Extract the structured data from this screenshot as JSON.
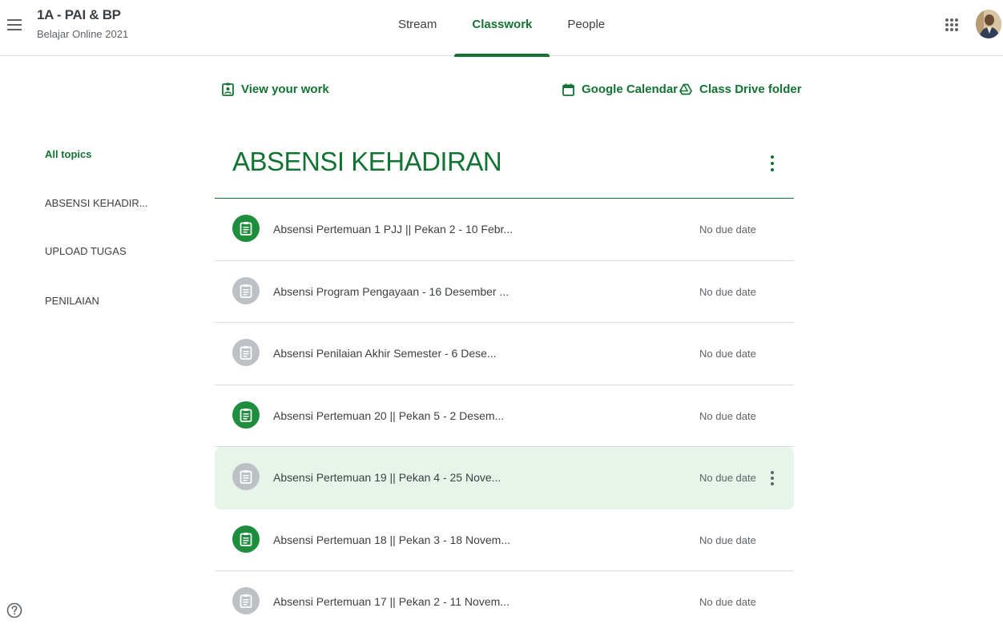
{
  "header": {
    "class_title": "1A - PAI & BP",
    "class_subtitle": "Belajar Online 2021",
    "menu_icon": "hamburger-menu-icon",
    "apps_icon": "google-apps-grid-icon",
    "tabs": [
      {
        "label": "Stream",
        "active": false
      },
      {
        "label": "Classwork",
        "active": true
      },
      {
        "label": "People",
        "active": false
      }
    ]
  },
  "links": {
    "view_work": "View your work",
    "calendar": "Google Calendar",
    "drive": "Class Drive folder"
  },
  "sidebar": {
    "items": [
      {
        "label": "All topics",
        "active": true
      },
      {
        "label": "ABSENSI KEHADIR..."
      },
      {
        "label": "UPLOAD TUGAS"
      },
      {
        "label": "PENILAIAN"
      }
    ]
  },
  "topic": {
    "title": "ABSENSI KEHADIRAN",
    "items": [
      {
        "title": "Absensi Pertemuan 1 PJJ || Pekan 2 - 10 Febr...",
        "due": "No due date",
        "status_color": "#1e8e3e"
      },
      {
        "title": "Absensi Program Pengayaan - 16 Desember ...",
        "due": "No due date",
        "status_color": "#bdc1c6"
      },
      {
        "title": "Absensi Penilaian Akhir Semester - 6 Dese...",
        "due": "No due date",
        "status_color": "#bdc1c6"
      },
      {
        "title": "Absensi Pertemuan 20 || Pekan 5 - 2 Desem...",
        "due": "No due date",
        "status_color": "#1e8e3e"
      },
      {
        "title": "Absensi Pertemuan 19 || Pekan 4 - 25 Nove...",
        "due": "No due date",
        "status_color": "#bdc1c6",
        "hovered": true
      },
      {
        "title": "Absensi Pertemuan 18 || Pekan 3 - 18 Novem...",
        "due": "No due date",
        "status_color": "#1e8e3e"
      },
      {
        "title": "Absensi Pertemuan 17 || Pekan 2 - 11 Novem...",
        "due": "No due date",
        "status_color": "#bdc1c6"
      }
    ]
  },
  "colors": {
    "accent": "#137333",
    "hover_bg": "#e6f4ea",
    "divider": "#dadce0"
  }
}
